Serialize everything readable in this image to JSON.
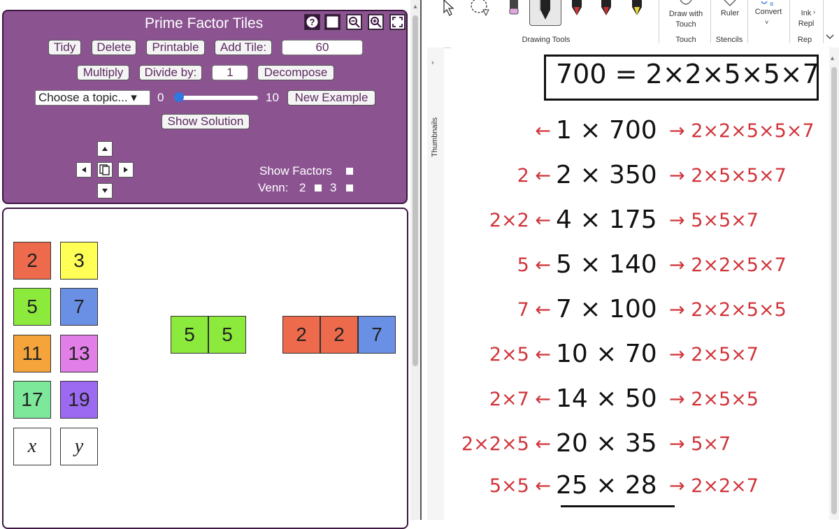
{
  "left_app": {
    "title": "Prime Factor Tiles",
    "row1": {
      "tidy": "Tidy",
      "delete": "Delete",
      "printable": "Printable",
      "add_tile": "Add Tile:",
      "add_tile_value": "60"
    },
    "row2": {
      "multiply": "Multiply",
      "divide_by": "Divide by:",
      "divide_value": "1",
      "decompose": "Decompose"
    },
    "row3": {
      "topic": "Choose a topic... ▾",
      "slider_min": "0",
      "slider_max": "10",
      "slider_value": 0,
      "new_example": "New Example"
    },
    "show_solution": "Show Solution",
    "show_factors": "Show Factors",
    "venn": {
      "label": "Venn:",
      "opt2": "2",
      "opt3": "3"
    },
    "palette": [
      {
        "label": "2",
        "color": "#ee6a4c"
      },
      {
        "label": "3",
        "color": "#ffff55"
      },
      {
        "label": "5",
        "color": "#8cea3c"
      },
      {
        "label": "7",
        "color": "#6a90e6"
      },
      {
        "label": "11",
        "color": "#f4a43a"
      },
      {
        "label": "13",
        "color": "#e27ee8"
      },
      {
        "label": "17",
        "color": "#7ee89a"
      },
      {
        "label": "19",
        "color": "#9c6af0"
      },
      {
        "label": "x",
        "color": "#ffffff"
      },
      {
        "label": "y",
        "color": "#ffffff"
      }
    ],
    "group_a": [
      "5",
      "5"
    ],
    "group_b": [
      "2",
      "2",
      "7"
    ]
  },
  "ribbon": {
    "drawing_tools": "Drawing Tools",
    "draw_with_touch": "Draw with Touch",
    "ruler": "Ruler",
    "convert": "Convert",
    "ink_replay": "Ink Repl",
    "touch": "Touch",
    "stencils": "Stencils",
    "rep": "Rep"
  },
  "thumbnails_label": "Thumbnails",
  "notes": {
    "header": "700 = 2×2×5×5×7",
    "rows": [
      {
        "left": "←",
        "mid": "1 × 700",
        "right": "→ 2×2×5×5×7"
      },
      {
        "left": "2 ←",
        "mid": "2 × 350",
        "right": "→ 2×5×5×7"
      },
      {
        "left": "2×2 ←",
        "mid": "4 × 175",
        "right": "→ 5×5×7"
      },
      {
        "left": "5 ←",
        "mid": "5 × 140",
        "right": "→ 2×2×5×7"
      },
      {
        "left": "7 ←",
        "mid": "7 × 100",
        "right": "→ 2×2×5×5"
      },
      {
        "left": "2×5 ←",
        "mid": "10 × 70",
        "right": "→ 2×5×7"
      },
      {
        "left": "2×7 ←",
        "mid": "14 × 50",
        "right": "→ 2×5×5"
      },
      {
        "left": "2×2×5 ←",
        "mid": "20 × 35",
        "right": "→ 5×7"
      },
      {
        "left": "5×5 ←",
        "mid": "25 × 28",
        "right": "→ 2×2×7"
      }
    ]
  },
  "colors": {
    "panel": "#8b5491",
    "panel_border": "#3d1540",
    "ink_red": "#d0343a"
  }
}
